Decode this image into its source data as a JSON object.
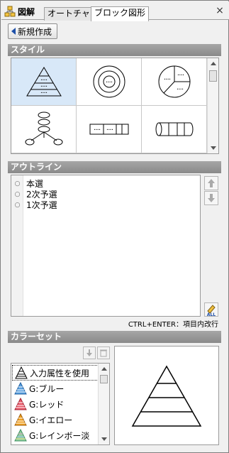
{
  "header": {
    "app_title": "図解",
    "tabs": [
      "オートチャート",
      "ブロック図形"
    ],
    "close_label": "×"
  },
  "toolbar": {
    "new_label": "新規作成"
  },
  "style_section": {
    "title": "スタイル",
    "items": [
      "pyramid",
      "concentric",
      "pie",
      "hub-spoke",
      "segmented-bar",
      "cylinder"
    ]
  },
  "outline_section": {
    "title": "アウトライン",
    "items": [
      "本選",
      "2次予選",
      "1次予選"
    ],
    "hint": "CTRL+ENTER：項目内改行"
  },
  "color_section": {
    "title": "カラーセット",
    "items": [
      {
        "label": "入力属性を使用",
        "color": "#ffffff"
      },
      {
        "label": "G:ブルー",
        "color": "#5aa0e0"
      },
      {
        "label": "G:レッド",
        "color": "#e85a6a"
      },
      {
        "label": "G:イエロー",
        "color": "#f0a020"
      },
      {
        "label": "G:レインボー淡",
        "color": "#90d0a0"
      }
    ]
  }
}
